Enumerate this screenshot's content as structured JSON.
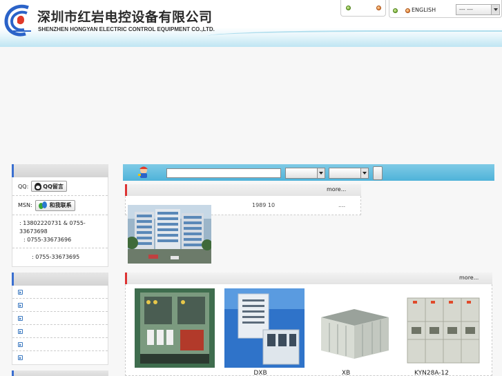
{
  "header": {
    "company_cn": "深圳市红岩电控设备有限公司",
    "company_en": "SHENZHEN HONGYAN ELECTRIC CONTROL EQUIPMENT CO.,LTD."
  },
  "lang": {
    "english_label": "ENGLISH",
    "select_value": "---   ---"
  },
  "sidebar": {
    "qq_label": "QQ:",
    "qq_button": "QQ留言",
    "msn_label": "MSN:",
    "msn_button": "和我联系",
    "phone": ":    13802220731 & 0755-33673698",
    "tel": ": 0755-33673696",
    "fax": ": 0755-33673695"
  },
  "about": {
    "more": "more...",
    "text": "1989 10",
    "dots": "...."
  },
  "products": {
    "more": "more...",
    "items": [
      {
        "caption": ""
      },
      {
        "caption": "DXB"
      },
      {
        "caption": "XB"
      },
      {
        "caption": "KYN28A-12"
      }
    ]
  },
  "colors": {
    "accent_blue": "#4fb3d9",
    "accent_red": "#dd3333",
    "sidebar_accent": "#3a6fd0"
  }
}
